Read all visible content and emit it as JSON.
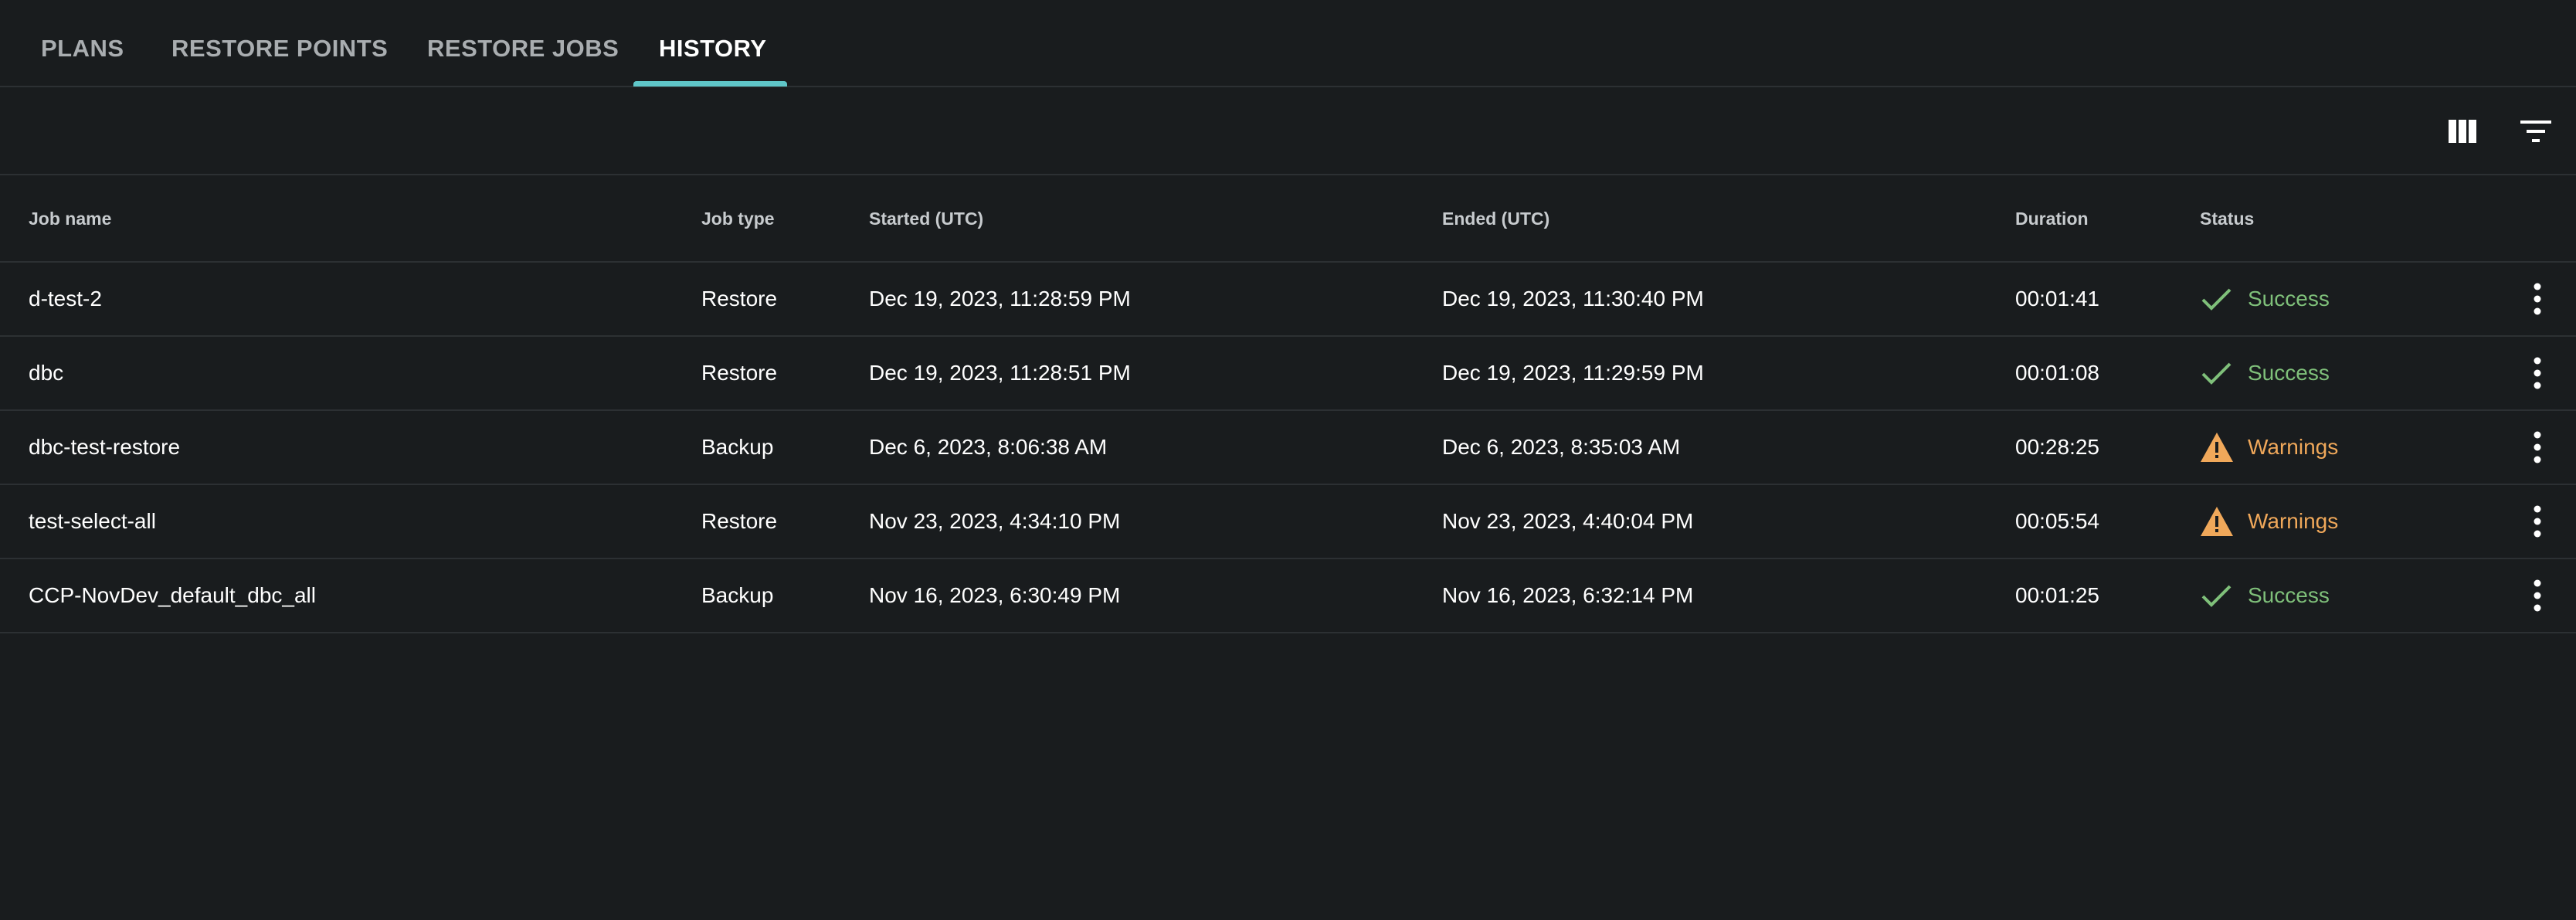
{
  "tabs": [
    {
      "label": "PLANS"
    },
    {
      "label": "RESTORE POINTS"
    },
    {
      "label": "RESTORE JOBS"
    },
    {
      "label": "HISTORY"
    }
  ],
  "active_tab": "HISTORY",
  "toolbar": {
    "icons": [
      "columns-icon",
      "filter-icon"
    ]
  },
  "table": {
    "columns": [
      "Job name",
      "Job type",
      "Started (UTC)",
      "Ended (UTC)",
      "Duration",
      "Status"
    ],
    "rows": [
      {
        "job_name": "d-test-2",
        "job_type": "Restore",
        "started": "Dec 19, 2023, 11:28:59 PM",
        "ended": "Dec 19, 2023, 11:30:40 PM",
        "duration": "00:01:41",
        "status": "Success",
        "status_icon": "check-icon"
      },
      {
        "job_name": "dbc",
        "job_type": "Restore",
        "started": "Dec 19, 2023, 11:28:51 PM",
        "ended": "Dec 19, 2023, 11:29:59 PM",
        "duration": "00:01:08",
        "status": "Success",
        "status_icon": "check-icon"
      },
      {
        "job_name": "dbc-test-restore",
        "job_type": "Backup",
        "started": "Dec 6, 2023, 8:06:38 AM",
        "ended": "Dec 6, 2023, 8:35:03 AM",
        "duration": "00:28:25",
        "status": "Warnings",
        "status_icon": "warning-icon"
      },
      {
        "job_name": "test-select-all",
        "job_type": "Restore",
        "started": "Nov 23, 2023, 4:34:10 PM",
        "ended": "Nov 23, 2023, 4:40:04 PM",
        "duration": "00:05:54",
        "status": "Warnings",
        "status_icon": "warning-icon"
      },
      {
        "job_name": "CCP-NovDev_default_dbc_all",
        "job_type": "Backup",
        "started": "Nov 16, 2023, 6:30:49 PM",
        "ended": "Nov 16, 2023, 6:32:14 PM",
        "duration": "00:01:25",
        "status": "Success",
        "status_icon": "check-icon"
      }
    ]
  },
  "colors": {
    "background": "#191c1e",
    "accent": "#5fc6c8",
    "success": "#7fc07a",
    "warning": "#f0a85a"
  }
}
